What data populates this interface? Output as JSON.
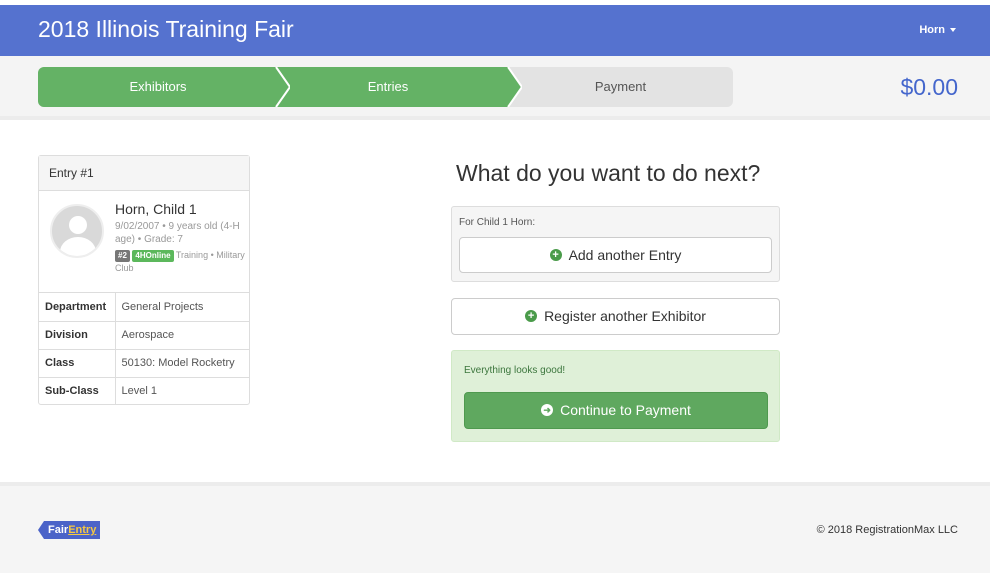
{
  "header": {
    "title": "2018 Illinois Training Fair",
    "user_menu": "Horn"
  },
  "progress": {
    "steps": [
      {
        "label": "Exhibitors",
        "state": "complete"
      },
      {
        "label": "Entries",
        "state": "active"
      },
      {
        "label": "Payment",
        "state": "pending"
      }
    ],
    "total": "$0.00"
  },
  "entry_card": {
    "header": "Entry #1",
    "name": "Horn, Child 1",
    "meta": "9/02/2007 • 9 years old (4-H age) • Grade: 7",
    "badge_number": "#2",
    "badge_source": "4HOnline",
    "club": "Training • Military Club",
    "details": [
      {
        "label": "Department",
        "value": "General Projects"
      },
      {
        "label": "Division",
        "value": "Aerospace"
      },
      {
        "label": "Class",
        "value": "50130: Model Rocketry"
      },
      {
        "label": "Sub-Class",
        "value": "Level 1"
      }
    ]
  },
  "next": {
    "heading": "What do you want to do next?",
    "for_child_label": "For Child 1 Horn:",
    "add_entry_label": "Add another Entry",
    "register_label": "Register another Exhibitor",
    "success_text": "Everything looks good!",
    "continue_label": "Continue to Payment"
  },
  "footer": {
    "logo_fair": "Fair",
    "logo_entry": "Entry",
    "copyright": "© 2018 RegistrationMax LLC"
  },
  "colors": {
    "navbar": "#5572cf",
    "step_complete": "#64b265",
    "step_pending": "#e3e3e3",
    "total": "#4466cc",
    "success_bg": "#dff0d8",
    "continue_button": "#5fa85f"
  }
}
